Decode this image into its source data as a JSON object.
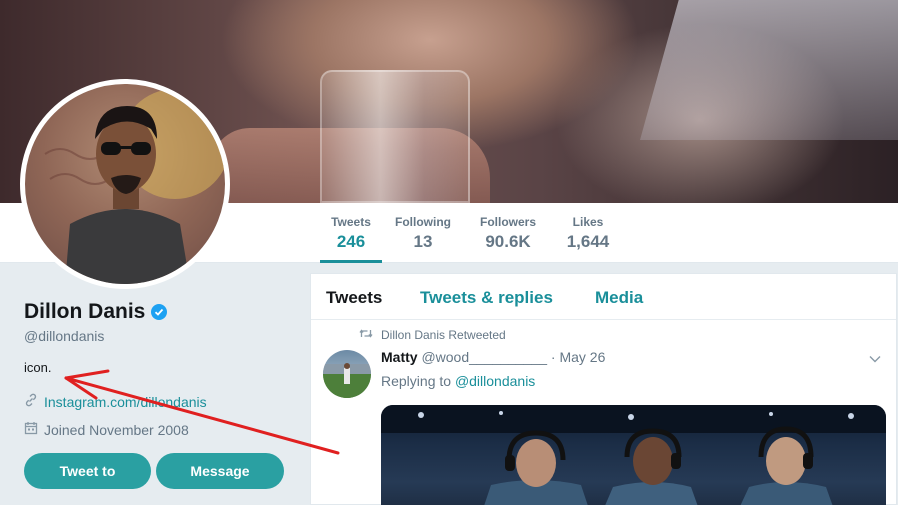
{
  "profile": {
    "name": "Dillon Danis",
    "handle": "@dillondanis",
    "bio": "icon.",
    "website": "Instagram.com/dillondanis",
    "joined": "Joined November 2008",
    "tweet_button": "Tweet to",
    "message_button": "Message"
  },
  "nav": {
    "stats": [
      {
        "label": "Tweets",
        "value": "246"
      },
      {
        "label": "Following",
        "value": "13"
      },
      {
        "label": "Followers",
        "value": "90.6K"
      },
      {
        "label": "Likes",
        "value": "1,644"
      }
    ]
  },
  "timeline": {
    "tabs": [
      {
        "label": "Tweets"
      },
      {
        "label": "Tweets & replies"
      },
      {
        "label": "Media"
      }
    ],
    "tweet": {
      "retweeted_by": "Dillon Danis Retweeted",
      "author_name": "Matty",
      "author_handle": "@wood__________",
      "date": "· May 26",
      "replying_prefix": "Replying to",
      "replying_to": "@dillondanis"
    }
  },
  "colors": {
    "accent": "#1a8f9a",
    "button": "#2aa0a2",
    "verified": "#1da1f2",
    "annotation_arrow": "#e02020"
  },
  "icons": {
    "verified": "verified-badge-icon",
    "link": "link-icon",
    "calendar": "calendar-icon",
    "retweet": "retweet-icon",
    "chevron": "chevron-down-icon"
  }
}
